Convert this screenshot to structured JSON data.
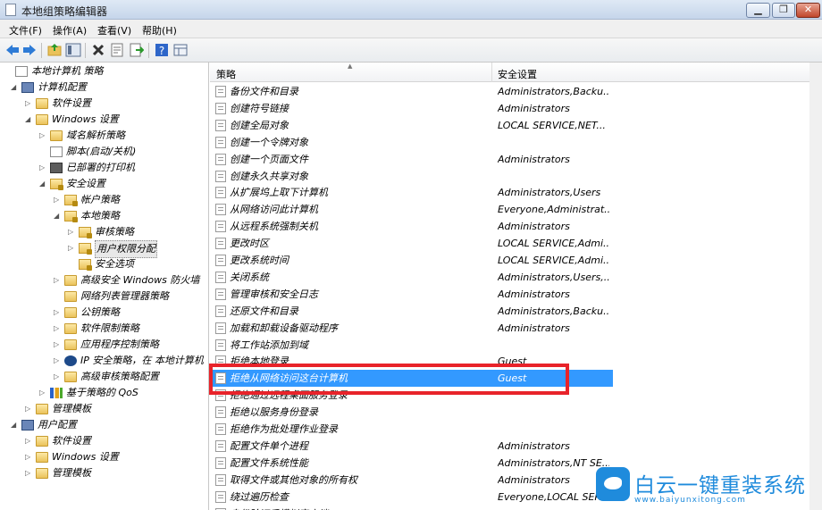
{
  "window": {
    "title": "本地组策略编辑器",
    "min_glyph": "▁",
    "restore_glyph": "❐",
    "close_glyph": "✕"
  },
  "menu": [
    "文件(F)",
    "操作(A)",
    "查看(V)",
    "帮助(H)"
  ],
  "toolbar_icons": [
    "back-arrow-icon",
    "forward-arrow-icon",
    "up-folder-icon",
    "show-tree-icon",
    "delete-icon",
    "properties-icon",
    "export-icon",
    "help-icon",
    "view-icon"
  ],
  "tree": [
    {
      "label": "本地计算机 策略",
      "level": 0,
      "expander": "",
      "icon": "docicon",
      "sel": false
    },
    {
      "label": "计算机配置",
      "level": 1,
      "expander": "◢",
      "icon": "computer",
      "sel": false
    },
    {
      "label": "软件设置",
      "level": 2,
      "expander": "▷",
      "icon": "folder",
      "sel": false
    },
    {
      "label": "Windows 设置",
      "level": 2,
      "expander": "◢",
      "icon": "folder",
      "sel": false
    },
    {
      "label": "域名解析策略",
      "level": 3,
      "expander": "▷",
      "icon": "folder",
      "sel": false
    },
    {
      "label": "脚本(启动/关机)",
      "level": 3,
      "expander": "",
      "icon": "docicon",
      "sel": false
    },
    {
      "label": "已部署的打印机",
      "level": 3,
      "expander": "▷",
      "icon": "printer",
      "sel": false
    },
    {
      "label": "安全设置",
      "level": 3,
      "expander": "◢",
      "icon": "folder-lock",
      "sel": false
    },
    {
      "label": "帐户策略",
      "level": 4,
      "expander": "▷",
      "icon": "folder-lock",
      "sel": false
    },
    {
      "label": "本地策略",
      "level": 4,
      "expander": "◢",
      "icon": "folder-lock",
      "sel": false
    },
    {
      "label": "审核策略",
      "level": 5,
      "expander": "▷",
      "icon": "folder-lock",
      "sel": false
    },
    {
      "label": "用户权限分配",
      "level": 5,
      "expander": "▷",
      "icon": "folder-lock",
      "sel": true
    },
    {
      "label": "安全选项",
      "level": 5,
      "expander": "",
      "icon": "folder-lock",
      "sel": false
    },
    {
      "label": "高级安全 Windows 防火墙",
      "level": 4,
      "expander": "▷",
      "icon": "folder",
      "sel": false
    },
    {
      "label": "网络列表管理器策略",
      "level": 4,
      "expander": "",
      "icon": "folder",
      "sel": false
    },
    {
      "label": "公钥策略",
      "level": 4,
      "expander": "▷",
      "icon": "folder",
      "sel": false
    },
    {
      "label": "软件限制策略",
      "level": 4,
      "expander": "▷",
      "icon": "folder",
      "sel": false
    },
    {
      "label": "应用程序控制策略",
      "level": 4,
      "expander": "▷",
      "icon": "folder",
      "sel": false
    },
    {
      "label": "IP 安全策略，在 本地计算机",
      "level": 4,
      "expander": "▷",
      "icon": "shield",
      "sel": false
    },
    {
      "label": "高级审核策略配置",
      "level": 4,
      "expander": "▷",
      "icon": "folder",
      "sel": false
    },
    {
      "label": "基于策略的 QoS",
      "level": 3,
      "expander": "▷",
      "icon": "chart",
      "sel": false
    },
    {
      "label": "管理模板",
      "level": 2,
      "expander": "▷",
      "icon": "folder",
      "sel": false
    },
    {
      "label": "用户配置",
      "level": 1,
      "expander": "◢",
      "icon": "computer",
      "sel": false
    },
    {
      "label": "软件设置",
      "level": 2,
      "expander": "▷",
      "icon": "folder",
      "sel": false
    },
    {
      "label": "Windows 设置",
      "level": 2,
      "expander": "▷",
      "icon": "folder",
      "sel": false
    },
    {
      "label": "管理模板",
      "level": 2,
      "expander": "▷",
      "icon": "folder",
      "sel": false
    }
  ],
  "list_header": {
    "col1": "策略",
    "col2": "安全设置",
    "sort_arrow": "▲"
  },
  "policies": [
    {
      "name": "备份文件和目录",
      "setting": "Administrators,Backu..."
    },
    {
      "name": "创建符号链接",
      "setting": "Administrators"
    },
    {
      "name": "创建全局对象",
      "setting": "LOCAL SERVICE,NET..."
    },
    {
      "name": "创建一个令牌对象",
      "setting": ""
    },
    {
      "name": "创建一个页面文件",
      "setting": "Administrators"
    },
    {
      "name": "创建永久共享对象",
      "setting": ""
    },
    {
      "name": "从扩展坞上取下计算机",
      "setting": "Administrators,Users"
    },
    {
      "name": "从网络访问此计算机",
      "setting": "Everyone,Administrat..."
    },
    {
      "name": "从远程系统强制关机",
      "setting": "Administrators"
    },
    {
      "name": "更改时区",
      "setting": "LOCAL SERVICE,Admi..."
    },
    {
      "name": "更改系统时间",
      "setting": "LOCAL SERVICE,Admi..."
    },
    {
      "name": "关闭系统",
      "setting": "Administrators,Users,..."
    },
    {
      "name": "管理审核和安全日志",
      "setting": "Administrators"
    },
    {
      "name": "还原文件和目录",
      "setting": "Administrators,Backu..."
    },
    {
      "name": "加载和卸载设备驱动程序",
      "setting": "Administrators"
    },
    {
      "name": "将工作站添加到域",
      "setting": ""
    },
    {
      "name": "拒绝本地登录",
      "setting": "Guest"
    },
    {
      "name": "拒绝从网络访问这台计算机",
      "setting": "Guest",
      "selected": true
    },
    {
      "name": "拒绝通过远程桌面服务登录",
      "setting": ""
    },
    {
      "name": "拒绝以服务身份登录",
      "setting": ""
    },
    {
      "name": "拒绝作为批处理作业登录",
      "setting": ""
    },
    {
      "name": "配置文件单个进程",
      "setting": "Administrators"
    },
    {
      "name": "配置文件系统性能",
      "setting": "Administrators,NT SE..."
    },
    {
      "name": "取得文件或其他对象的所有权",
      "setting": "Administrators"
    },
    {
      "name": "绕过遍历检查",
      "setting": "Everyone,LOCAL SER..."
    },
    {
      "name": "身份验证后模拟客户端",
      "setting": ""
    }
  ],
  "watermark": {
    "brand": "白云一键重装系统",
    "url": "www.baiyunxitong.com"
  },
  "colors": {
    "selection": "#3399ff",
    "highlight_box": "#e8232a",
    "brand": "#1f8bdc"
  }
}
